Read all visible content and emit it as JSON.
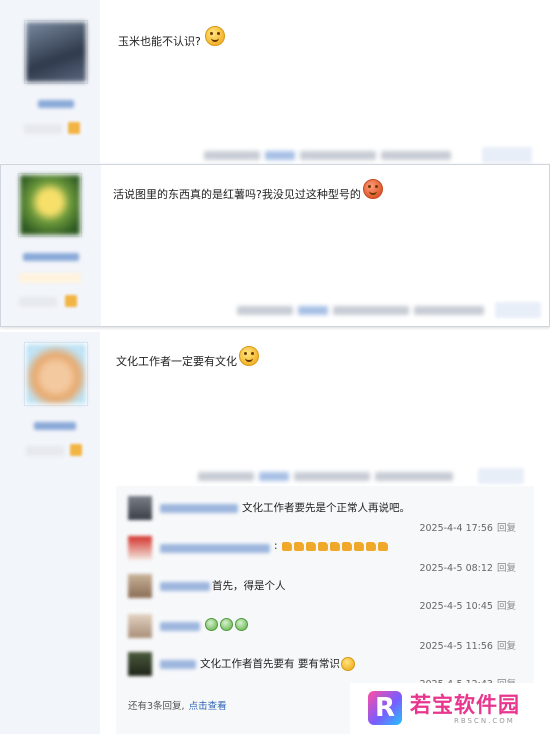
{
  "posts": [
    {
      "message": "玉米也能不认识?",
      "emoji": "grimace-emoji"
    },
    {
      "message": "活说图里的东西真的是红薯吗?我没见过这种型号的",
      "emoji": "angry-emoji"
    },
    {
      "message": "文化工作者一定要有文化",
      "emoji": "smile-emoji"
    }
  ],
  "sub_replies": [
    {
      "text": "文化工作者要先是个正常人再说吧。",
      "time": "2025-4-4 17:56",
      "reply": "回复"
    },
    {
      "text": ":",
      "time": "2025-4-5 08:12",
      "reply": "回复",
      "emoji_row": "thumbs-up x9"
    },
    {
      "text": "首先，得是个人",
      "time": "2025-4-5 10:45",
      "reply": "回复"
    },
    {
      "text": "",
      "time": "2025-4-5 11:56",
      "reply": "回复",
      "emoji_row": "crying x3"
    },
    {
      "text": "文化工作者首先要有 要有常识",
      "time": "2025-4-5 12:43",
      "reply": "回复"
    }
  ],
  "more_replies": {
    "text": "还有3条回复,",
    "link": "点击查看"
  },
  "watermark": {
    "title": "若宝软件园",
    "sub": "RBSCN.COM"
  },
  "colors": {
    "sidebar_bg": "#f2f5fa",
    "subreply_bg": "#f7f8fa",
    "link": "#2d64b3",
    "watermark": "#e8368f"
  }
}
